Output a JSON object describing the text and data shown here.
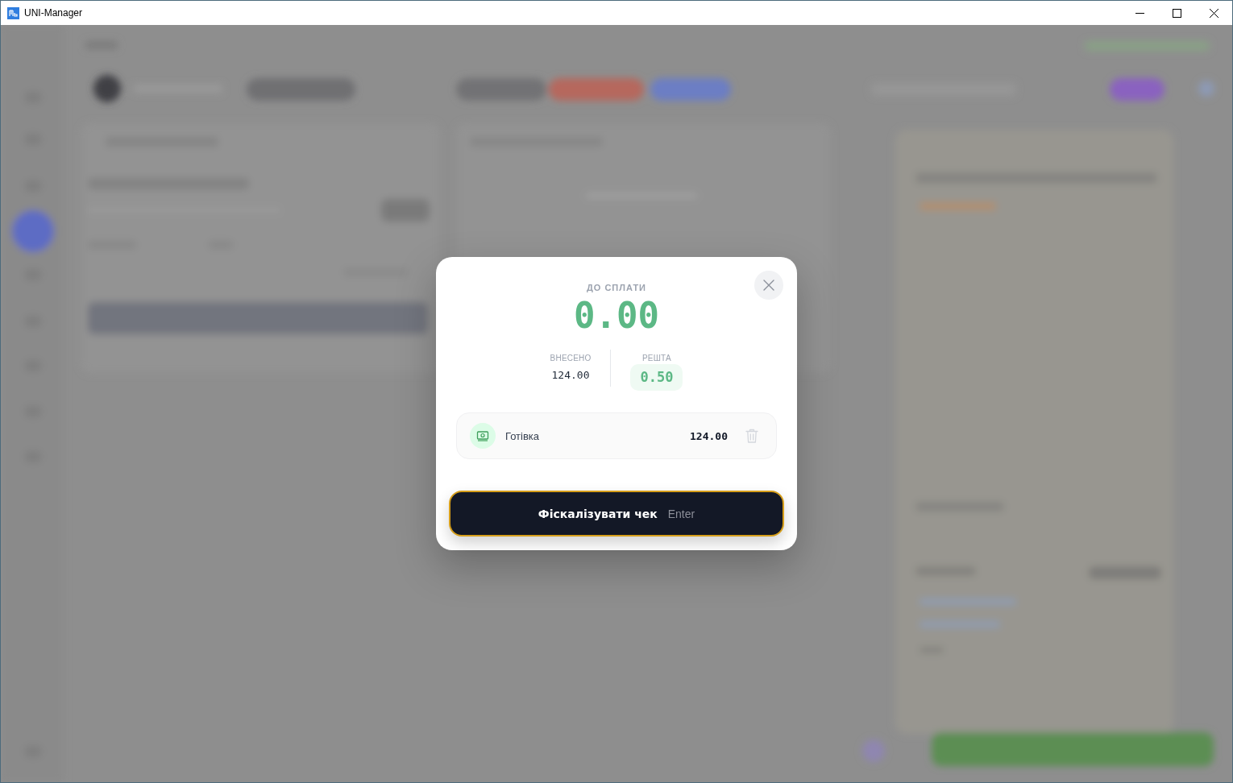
{
  "window": {
    "title": "UNI-Manager"
  },
  "payment_dialog": {
    "due_label": "ДО СПЛАТИ",
    "due_amount": "0.00",
    "paid": {
      "label": "ВНЕСЕНО",
      "value": "124.00"
    },
    "change": {
      "label": "РЕШТА",
      "value": "0.50"
    },
    "payments": [
      {
        "kind": "cash",
        "name": "Готівка",
        "amount": "124.00"
      }
    ],
    "fiscalize_button": {
      "label": "Фіскалізувати чек",
      "shortcut": "Enter",
      "focused": true
    }
  }
}
